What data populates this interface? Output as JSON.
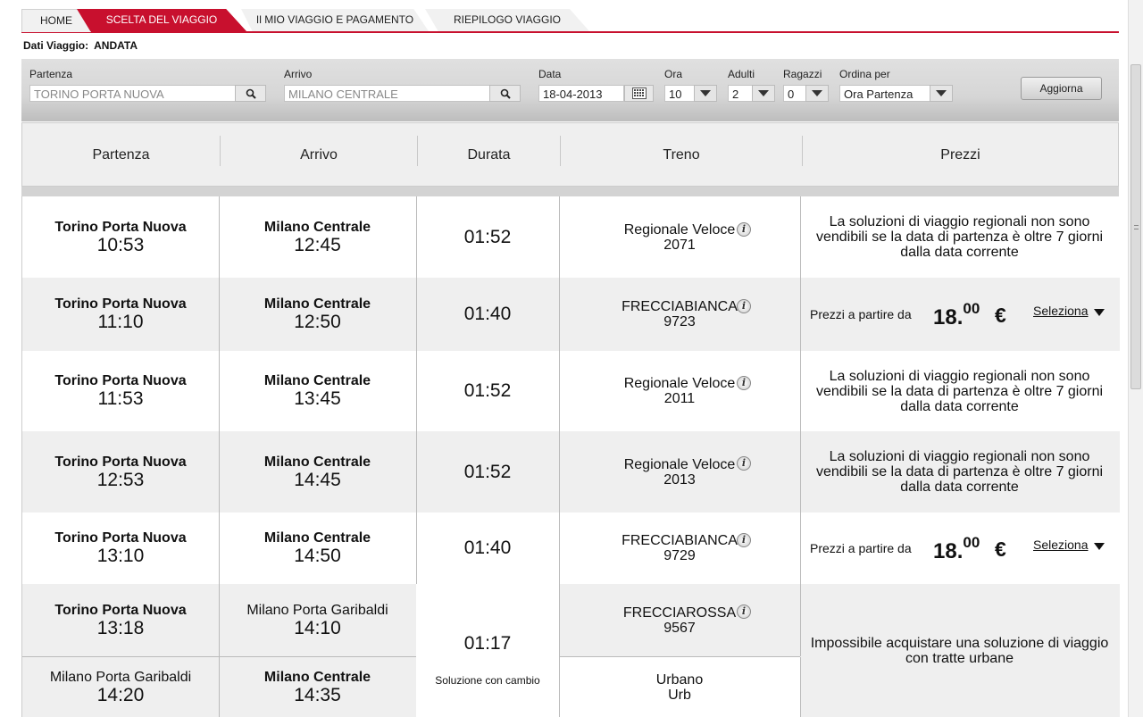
{
  "breadcrumb": [
    "HOME",
    "SCELTA DEL VIAGGIO",
    "Il MIO VIAGGIO E PAGAMENTO",
    "RIEPILOGO VIAGGIO"
  ],
  "dati_viaggio": {
    "label": "Dati Viaggio:",
    "value": "ANDATA"
  },
  "search": {
    "partenza_label": "Partenza",
    "partenza_value": "TORINO PORTA NUOVA",
    "arrivo_label": "Arrivo",
    "arrivo_value": "MILANO CENTRALE",
    "data_label": "Data",
    "data_value": "18-04-2013",
    "ora_label": "Ora",
    "ora_value": "10",
    "adulti_label": "Adulti",
    "adulti_value": "2",
    "ragazzi_label": "Ragazzi",
    "ragazzi_value": "0",
    "ordina_label": "Ordina per",
    "ordina_value": "Ora Partenza",
    "aggiorna": "Aggiorna"
  },
  "columns": [
    "Partenza",
    "Arrivo",
    "Durata",
    "Treno",
    "Prezzi"
  ],
  "rows": [
    {
      "dep_station": "Torino Porta Nuova",
      "dep_time": "10:53",
      "arr_station": "Milano Centrale",
      "arr_time": "12:45",
      "duration": "01:52",
      "train_name": "Regionale Veloce",
      "train_number": "2071",
      "note": "La soluzioni di viaggio regionali non sono vendibili se la data di partenza è oltre 7 giorni dalla data corrente"
    },
    {
      "dep_station": "Torino Porta Nuova",
      "dep_time": "11:10",
      "arr_station": "Milano Centrale",
      "arr_time": "12:50",
      "duration": "01:40",
      "train_name": "FRECCIABIANCA",
      "train_number": "9723",
      "price_from": "Prezzi a partire da",
      "price_int": "18.",
      "price_dec": "00",
      "currency": "€",
      "select": "Seleziona"
    },
    {
      "dep_station": "Torino Porta Nuova",
      "dep_time": "11:53",
      "arr_station": "Milano Centrale",
      "arr_time": "13:45",
      "duration": "01:52",
      "train_name": "Regionale Veloce",
      "train_number": "2011",
      "note": "La soluzioni di viaggio regionali non sono vendibili se la data di partenza è oltre 7 giorni dalla data corrente"
    },
    {
      "dep_station": "Torino Porta Nuova",
      "dep_time": "12:53",
      "arr_station": "Milano Centrale",
      "arr_time": "14:45",
      "duration": "01:52",
      "train_name": "Regionale Veloce",
      "train_number": "2013",
      "note": "La soluzioni di viaggio regionali non sono vendibili se la data di partenza è oltre 7 giorni dalla data corrente"
    },
    {
      "dep_station": "Torino Porta Nuova",
      "dep_time": "13:10",
      "arr_station": "Milano Centrale",
      "arr_time": "14:50",
      "duration": "01:40",
      "train_name": "FRECCIABIANCA",
      "train_number": "9729",
      "price_from": "Prezzi a partire da",
      "price_int": "18.",
      "price_dec": "00",
      "currency": "€",
      "select": "Seleziona"
    }
  ],
  "change_solution": {
    "leg1": {
      "dep_station": "Torino Porta Nuova",
      "dep_time": "13:18",
      "arr_station": "Milano Porta Garibaldi",
      "arr_time": "14:10",
      "train_name": "FRECCIAROSSA",
      "train_number": "9567"
    },
    "leg2": {
      "dep_station": "Milano Porta Garibaldi",
      "dep_time": "14:20",
      "arr_station": "Milano Centrale",
      "arr_time": "14:35",
      "train_name": "Urbano",
      "train_number": "Urb"
    },
    "duration": "01:17",
    "duration_note": "Soluzione con cambio",
    "note": "Impossibile acquistare una soluzione di viaggio con tratte urbane"
  }
}
